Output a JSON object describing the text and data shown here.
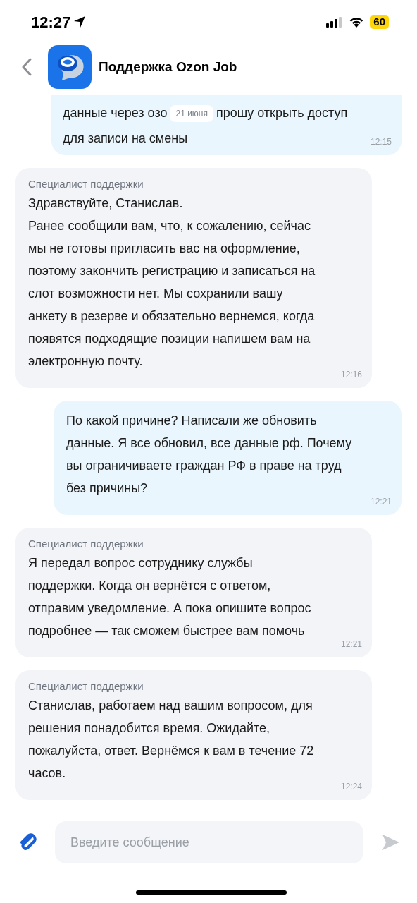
{
  "status_bar": {
    "time": "12:27",
    "battery": "60"
  },
  "header": {
    "title": "Поддержка Ozon Job"
  },
  "first_message": {
    "before_chip": "данные через озо",
    "date_chip": "21 июня",
    "after_chip": "прошу открыть доступ",
    "second_line": "для записи на смены",
    "time": "12:15"
  },
  "messages": [
    {
      "kind": "incoming",
      "sender": "Специалист поддержки",
      "text": "Здравствуйте, Станислав.\nРанее сообщили вам, что, к сожалению, сейчас\nмы не готовы пригласить вас на оформление,\nпоэтому закончить регистрацию и записаться на\nслот возможности нет. Мы сохранили вашу\nанкету в резерве и обязательно вернемся, когда\nпоявятся подходящие позиции напишем вам на\nэлектронную почту.",
      "time": "12:16"
    },
    {
      "kind": "outgoing",
      "text": "По какой причине? Написали же обновить\nданные. Я все обновил, все данные рф. Почему\nвы ограничиваете граждан РФ в праве на труд\nбез причины?",
      "time": "12:21"
    },
    {
      "kind": "incoming",
      "sender": "Специалист поддержки",
      "text": "Я передал вопрос сотруднику службы\nподдержки. Когда он вернётся с ответом,\nотправим уведомление. А пока опишите вопрос\nподробнее — так сможем быстрее вам помочь",
      "time": "12:21"
    },
    {
      "kind": "incoming",
      "sender": "Специалист поддержки",
      "text": "Станислав, работаем над вашим вопросом, для\nрешения понадобится время. Ожидайте,\nпожалуйста, ответ. Вернёмся к вам в течение 72\nчасов.",
      "time": "12:24"
    }
  ],
  "composer": {
    "placeholder": "Введите сообщение"
  }
}
